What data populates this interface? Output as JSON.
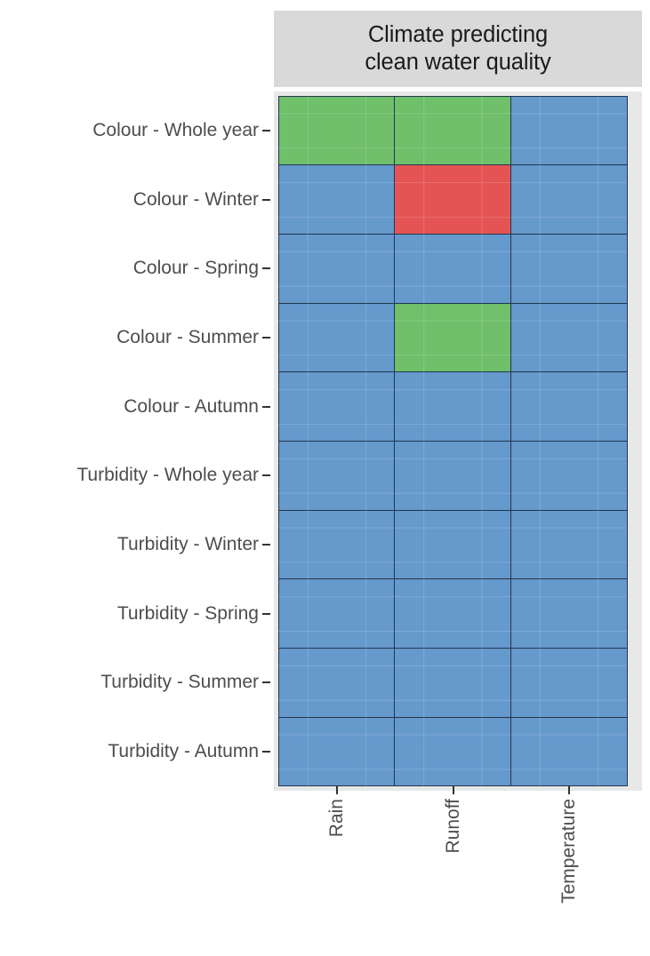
{
  "figure": {
    "strip_title": "Climate predicting\nclean water quality",
    "strip_title_line1": "Climate predicting",
    "strip_title_line2": "clean water quality"
  },
  "colors": {
    "blue": "#6699CC",
    "green": "#6FBF6B",
    "red": "#E55455",
    "cell_border": "#21364F",
    "strip_background": "#D9D9D9",
    "panel_background": "#E8E8E8",
    "axis_text": "#4d4d4d",
    "tick_mark": "#333333",
    "page_background": "#FFFFFF"
  },
  "chart_data": {
    "type": "heatmap",
    "title": "Climate predicting clean water quality",
    "xlabel": "",
    "ylabel": "",
    "grid": true,
    "legend_position": "none",
    "x_categories": [
      "Rain",
      "Runoff",
      "Temperature"
    ],
    "y_categories": [
      "Colour - Whole year",
      "Colour - Winter",
      "Colour - Spring",
      "Colour - Summer",
      "Colour - Autumn",
      "Turbidity - Whole year",
      "Turbidity - Winter",
      "Turbidity - Spring",
      "Turbidity - Summer",
      "Turbidity - Autumn"
    ],
    "category_levels": [
      "blue",
      "green",
      "red"
    ],
    "cells": [
      {
        "row": "Colour - Whole year",
        "values": [
          "green",
          "green",
          "blue"
        ]
      },
      {
        "row": "Colour - Winter",
        "values": [
          "blue",
          "red",
          "blue"
        ]
      },
      {
        "row": "Colour - Spring",
        "values": [
          "blue",
          "blue",
          "blue"
        ]
      },
      {
        "row": "Colour - Summer",
        "values": [
          "blue",
          "green",
          "blue"
        ]
      },
      {
        "row": "Colour - Autumn",
        "values": [
          "blue",
          "blue",
          "blue"
        ]
      },
      {
        "row": "Turbidity - Whole year",
        "values": [
          "blue",
          "blue",
          "blue"
        ]
      },
      {
        "row": "Turbidity - Winter",
        "values": [
          "blue",
          "blue",
          "blue"
        ]
      },
      {
        "row": "Turbidity - Spring",
        "values": [
          "blue",
          "blue",
          "blue"
        ]
      },
      {
        "row": "Turbidity - Summer",
        "values": [
          "blue",
          "blue",
          "blue"
        ]
      },
      {
        "row": "Turbidity - Autumn",
        "values": [
          "blue",
          "blue",
          "blue"
        ]
      }
    ]
  }
}
